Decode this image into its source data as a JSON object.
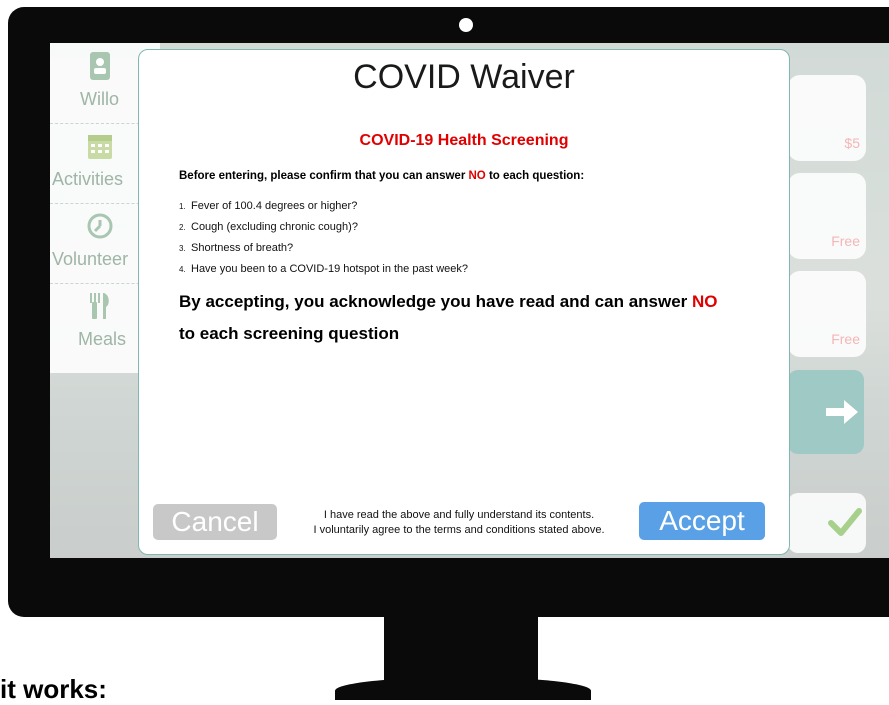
{
  "sidebar": {
    "items": [
      {
        "label": "Willo",
        "icon": "book-icon"
      },
      {
        "label": "Activities",
        "icon": "calendar-icon"
      },
      {
        "label": "Volunteer",
        "icon": "clock-icon"
      },
      {
        "label": "Meals",
        "icon": "fork-knife-icon"
      }
    ]
  },
  "cards": [
    {
      "price": "$5"
    },
    {
      "price": "Free"
    },
    {
      "price": "Free"
    }
  ],
  "modal": {
    "title": "COVID Waiver",
    "screening_title": "COVID-19 Health Screening",
    "intro_prefix": "Before entering, please confirm that you can answer ",
    "intro_no": "NO",
    "intro_suffix": " to each question:",
    "questions": [
      {
        "num": "1.",
        "text": "Fever of 100.4 degrees or higher?"
      },
      {
        "num": "2.",
        "text": "Cough (excluding chronic cough)?"
      },
      {
        "num": "3.",
        "text": "Shortness of breath?"
      },
      {
        "num": "4.",
        "text": "Have you been to a COVID-19 hotspot in the past week?"
      }
    ],
    "ack_prefix": "By accepting, you acknowledge you have read and can answer ",
    "ack_no": "NO",
    "ack_suffix": " to each screening question",
    "cancel_label": "Cancel",
    "accept_label": "Accept",
    "terms_line1": "I have read the above and fully understand its contents.",
    "terms_line2": "I voluntarily agree to the terms and conditions stated above."
  },
  "footer": {
    "text": "it works:"
  },
  "colors": {
    "accent_red": "#e00000",
    "accept_blue": "#5aa0e6",
    "cancel_gray": "#c8c8c8"
  }
}
